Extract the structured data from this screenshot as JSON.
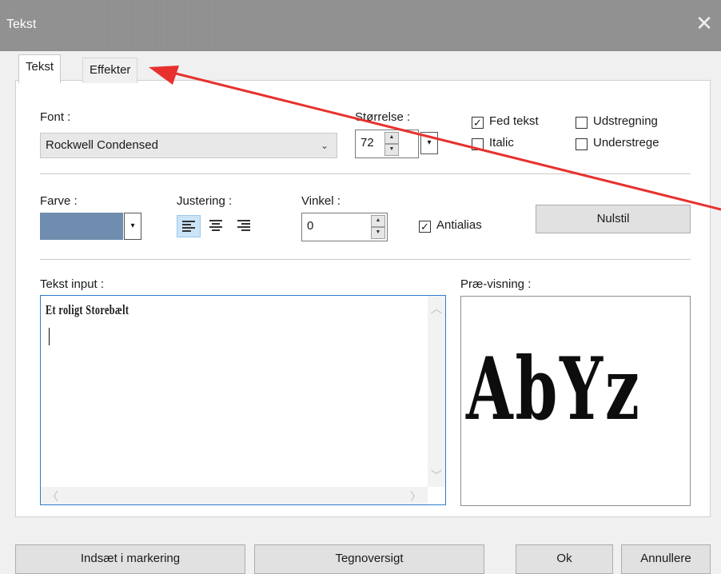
{
  "window": {
    "title": "Tekst",
    "close_glyph": "✕"
  },
  "tabs": [
    {
      "label": "Tekst",
      "active": true
    },
    {
      "label": "Effekter",
      "active": false
    }
  ],
  "font": {
    "label": "Font :",
    "value": "Rockwell Condensed"
  },
  "size": {
    "label": "Størrelse :",
    "value": "72"
  },
  "checkboxes": {
    "bold": {
      "label": "Fed tekst",
      "checked": true
    },
    "italic": {
      "label": "Italic",
      "checked": false
    },
    "strikethrough": {
      "label": "Udstregning",
      "checked": false
    },
    "underline": {
      "label": "Understrege",
      "checked": false
    },
    "antialias": {
      "label": "Antialias",
      "checked": true
    }
  },
  "color": {
    "label": "Farve :",
    "value": "#6f8eaf"
  },
  "justify": {
    "label": "Justering :",
    "options": [
      "left",
      "center",
      "right"
    ],
    "selected": "left"
  },
  "angle": {
    "label": "Vinkel :",
    "value": "0"
  },
  "reset_label": "Nulstil",
  "text_input": {
    "label": "Tekst input :",
    "value": "Et roligt Storebælt"
  },
  "preview": {
    "label": "Præ-visning :",
    "sample": "AbYz"
  },
  "footer": {
    "insert_label": "Indsæt i markering",
    "charmap_label": "Tegnoversigt",
    "ok_label": "Ok",
    "cancel_label": "Annullere"
  },
  "annotation": {
    "color": "#e8302f"
  },
  "icons": {
    "check": "✓",
    "chevron_down": "⌄",
    "up": "▲",
    "down": "▼",
    "scroll_up": "︿",
    "scroll_down": "﹀",
    "scroll_left": "〈",
    "scroll_right": "〉",
    "drop": "▾"
  }
}
